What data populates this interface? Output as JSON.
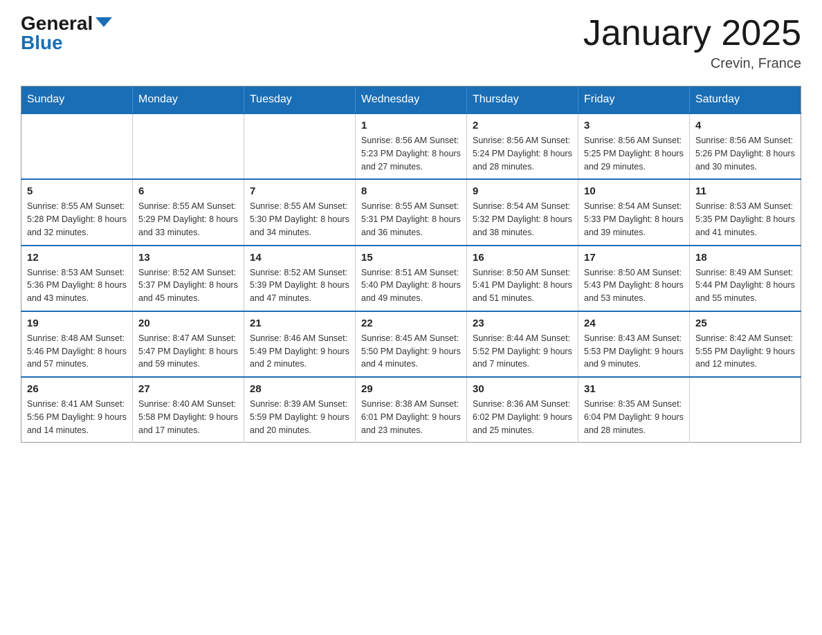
{
  "logo": {
    "general": "General",
    "blue": "Blue"
  },
  "title": "January 2025",
  "subtitle": "Crevin, France",
  "days_of_week": [
    "Sunday",
    "Monday",
    "Tuesday",
    "Wednesday",
    "Thursday",
    "Friday",
    "Saturday"
  ],
  "weeks": [
    [
      {
        "day": "",
        "info": ""
      },
      {
        "day": "",
        "info": ""
      },
      {
        "day": "",
        "info": ""
      },
      {
        "day": "1",
        "info": "Sunrise: 8:56 AM\nSunset: 5:23 PM\nDaylight: 8 hours and 27 minutes."
      },
      {
        "day": "2",
        "info": "Sunrise: 8:56 AM\nSunset: 5:24 PM\nDaylight: 8 hours and 28 minutes."
      },
      {
        "day": "3",
        "info": "Sunrise: 8:56 AM\nSunset: 5:25 PM\nDaylight: 8 hours and 29 minutes."
      },
      {
        "day": "4",
        "info": "Sunrise: 8:56 AM\nSunset: 5:26 PM\nDaylight: 8 hours and 30 minutes."
      }
    ],
    [
      {
        "day": "5",
        "info": "Sunrise: 8:55 AM\nSunset: 5:28 PM\nDaylight: 8 hours and 32 minutes."
      },
      {
        "day": "6",
        "info": "Sunrise: 8:55 AM\nSunset: 5:29 PM\nDaylight: 8 hours and 33 minutes."
      },
      {
        "day": "7",
        "info": "Sunrise: 8:55 AM\nSunset: 5:30 PM\nDaylight: 8 hours and 34 minutes."
      },
      {
        "day": "8",
        "info": "Sunrise: 8:55 AM\nSunset: 5:31 PM\nDaylight: 8 hours and 36 minutes."
      },
      {
        "day": "9",
        "info": "Sunrise: 8:54 AM\nSunset: 5:32 PM\nDaylight: 8 hours and 38 minutes."
      },
      {
        "day": "10",
        "info": "Sunrise: 8:54 AM\nSunset: 5:33 PM\nDaylight: 8 hours and 39 minutes."
      },
      {
        "day": "11",
        "info": "Sunrise: 8:53 AM\nSunset: 5:35 PM\nDaylight: 8 hours and 41 minutes."
      }
    ],
    [
      {
        "day": "12",
        "info": "Sunrise: 8:53 AM\nSunset: 5:36 PM\nDaylight: 8 hours and 43 minutes."
      },
      {
        "day": "13",
        "info": "Sunrise: 8:52 AM\nSunset: 5:37 PM\nDaylight: 8 hours and 45 minutes."
      },
      {
        "day": "14",
        "info": "Sunrise: 8:52 AM\nSunset: 5:39 PM\nDaylight: 8 hours and 47 minutes."
      },
      {
        "day": "15",
        "info": "Sunrise: 8:51 AM\nSunset: 5:40 PM\nDaylight: 8 hours and 49 minutes."
      },
      {
        "day": "16",
        "info": "Sunrise: 8:50 AM\nSunset: 5:41 PM\nDaylight: 8 hours and 51 minutes."
      },
      {
        "day": "17",
        "info": "Sunrise: 8:50 AM\nSunset: 5:43 PM\nDaylight: 8 hours and 53 minutes."
      },
      {
        "day": "18",
        "info": "Sunrise: 8:49 AM\nSunset: 5:44 PM\nDaylight: 8 hours and 55 minutes."
      }
    ],
    [
      {
        "day": "19",
        "info": "Sunrise: 8:48 AM\nSunset: 5:46 PM\nDaylight: 8 hours and 57 minutes."
      },
      {
        "day": "20",
        "info": "Sunrise: 8:47 AM\nSunset: 5:47 PM\nDaylight: 8 hours and 59 minutes."
      },
      {
        "day": "21",
        "info": "Sunrise: 8:46 AM\nSunset: 5:49 PM\nDaylight: 9 hours and 2 minutes."
      },
      {
        "day": "22",
        "info": "Sunrise: 8:45 AM\nSunset: 5:50 PM\nDaylight: 9 hours and 4 minutes."
      },
      {
        "day": "23",
        "info": "Sunrise: 8:44 AM\nSunset: 5:52 PM\nDaylight: 9 hours and 7 minutes."
      },
      {
        "day": "24",
        "info": "Sunrise: 8:43 AM\nSunset: 5:53 PM\nDaylight: 9 hours and 9 minutes."
      },
      {
        "day": "25",
        "info": "Sunrise: 8:42 AM\nSunset: 5:55 PM\nDaylight: 9 hours and 12 minutes."
      }
    ],
    [
      {
        "day": "26",
        "info": "Sunrise: 8:41 AM\nSunset: 5:56 PM\nDaylight: 9 hours and 14 minutes."
      },
      {
        "day": "27",
        "info": "Sunrise: 8:40 AM\nSunset: 5:58 PM\nDaylight: 9 hours and 17 minutes."
      },
      {
        "day": "28",
        "info": "Sunrise: 8:39 AM\nSunset: 5:59 PM\nDaylight: 9 hours and 20 minutes."
      },
      {
        "day": "29",
        "info": "Sunrise: 8:38 AM\nSunset: 6:01 PM\nDaylight: 9 hours and 23 minutes."
      },
      {
        "day": "30",
        "info": "Sunrise: 8:36 AM\nSunset: 6:02 PM\nDaylight: 9 hours and 25 minutes."
      },
      {
        "day": "31",
        "info": "Sunrise: 8:35 AM\nSunset: 6:04 PM\nDaylight: 9 hours and 28 minutes."
      },
      {
        "day": "",
        "info": ""
      }
    ]
  ]
}
